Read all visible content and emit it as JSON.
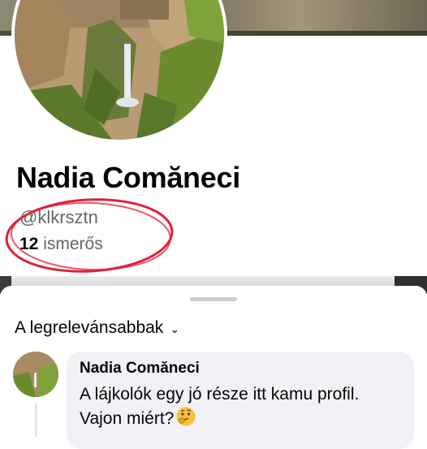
{
  "profile": {
    "name": "Nadia Comăneci",
    "handle": "@klkrsztn",
    "friends_count": "12",
    "friends_label": "ismerős"
  },
  "sheet": {
    "sort_label": "A legrelevánsabbak"
  },
  "comment": {
    "author": "Nadia Comăneci",
    "text": "A lájkolók egy jó része itt kamu profil. Vajon miért?",
    "emoji": "thinking-face-icon"
  },
  "colors": {
    "text_primary": "#050505",
    "text_secondary": "#65676b",
    "bubble_bg": "#f0f2f5",
    "annotation_red": "#e0203a"
  },
  "icons": [
    "chevron-down-icon",
    "thinking-face-icon"
  ]
}
